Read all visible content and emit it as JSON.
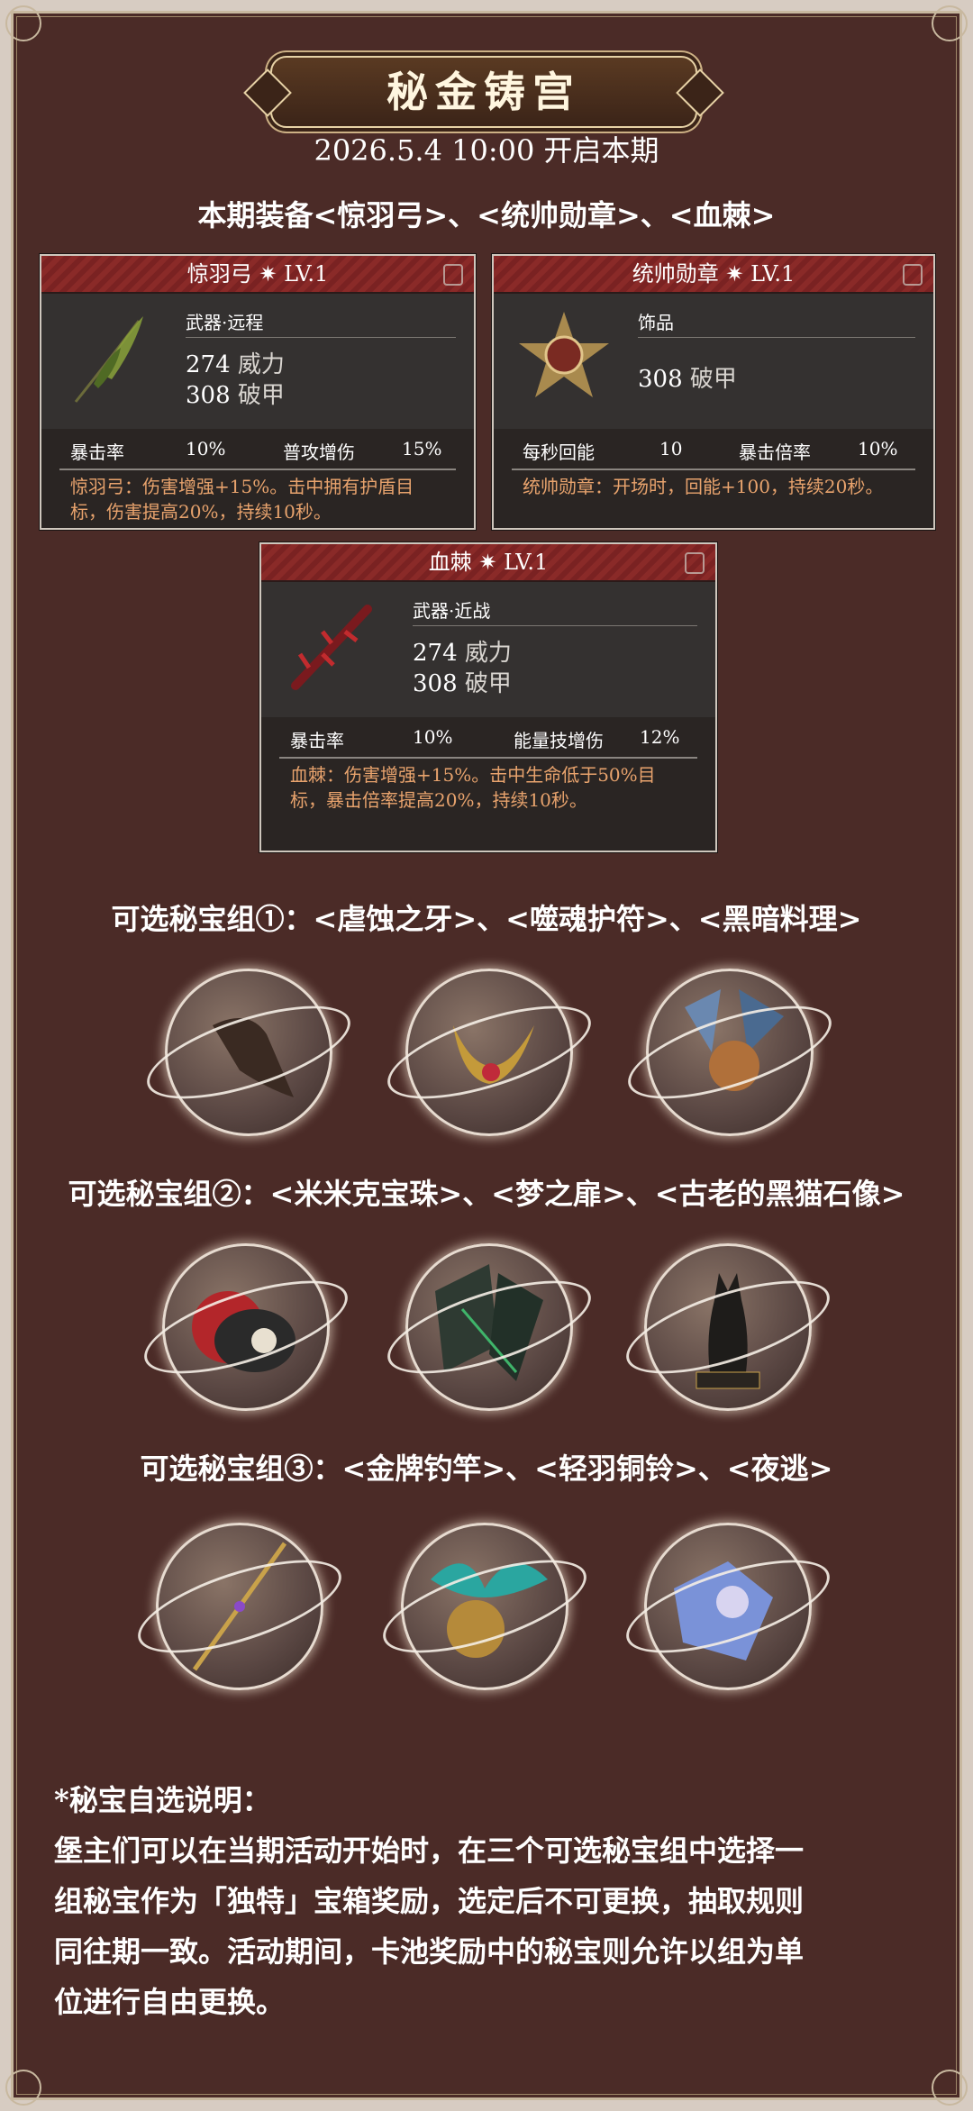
{
  "header": {
    "title": "秘金铸宫",
    "subtitle": "2026.5.4 10:00 开启本期"
  },
  "equipment_heading": "本期装备<惊羽弓>、<统帅勋章>、<血棘>",
  "cards": [
    {
      "name": "惊羽弓 ✷ LV.1",
      "type": "武器·远程",
      "stat1_value": "274",
      "stat1_label": "威力",
      "stat2_value": "308",
      "stat2_label": "破甲",
      "row_label1": "暴击率",
      "row_value1": "10%",
      "row_label2": "普攻增伤",
      "row_value2": "15%",
      "desc": "惊羽弓：伤害增强+15%。击中拥有护盾目标，伤害提高20%，持续10秒。"
    },
    {
      "name": "统帅勋章 ✷ LV.1",
      "type": "饰品",
      "stat1_value": "308",
      "stat1_label": "破甲",
      "row_label1": "每秒回能",
      "row_value1": "10",
      "row_label2": "暴击倍率",
      "row_value2": "10%",
      "desc": "统帅勋章：开场时，回能+100，持续20秒。"
    },
    {
      "name": "血棘 ✷ LV.1",
      "type": "武器·近战",
      "stat1_value": "274",
      "stat1_label": "威力",
      "stat2_value": "308",
      "stat2_label": "破甲",
      "row_label1": "暴击率",
      "row_value1": "10%",
      "row_label2": "能量技增伤",
      "row_value2": "12%",
      "desc": "血棘：伤害增强+15%。击中生命低于50%目标，暴击倍率提高20%，持续10秒。"
    }
  ],
  "groups": [
    {
      "heading": "可选秘宝组①：<虐蚀之牙>、<噬魂护符>、<黑暗料理>"
    },
    {
      "heading": "可选秘宝组②：<米米克宝珠>、<梦之扉>、<古老的黑猫石像>"
    },
    {
      "heading": "可选秘宝组③：<金牌钓竿>、<轻羽铜铃>、<夜逃>"
    }
  ],
  "notes": {
    "title": "*秘宝自选说明：",
    "line1": "堡主们可以在当期活动开始时，在三个可选秘宝组中选择一",
    "line2": "组秘宝作为「独特」宝箱奖励，选定后不可更换，抽取规则",
    "line3": "同往期一致。活动期间，卡池奖励中的秘宝则允许以组为单",
    "line4": "位进行自由更换。"
  },
  "colors": {
    "background": "#4b2b27",
    "card_header": "#8a2a28",
    "desc_text": "#e8a36d"
  }
}
